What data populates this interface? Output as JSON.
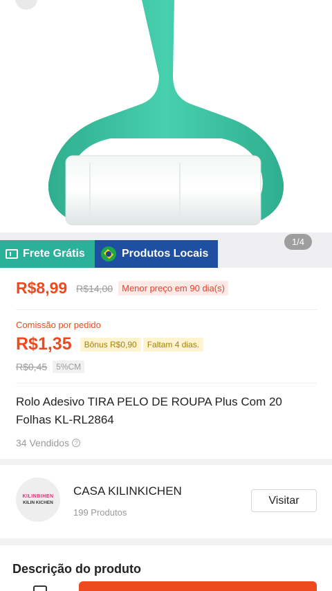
{
  "product": {
    "image_counter": "1/4",
    "tags": {
      "frete": "Frete Grátis",
      "local": "Produtos Locais"
    },
    "price": "R$8,99",
    "old_price": "R$14,00",
    "low_price_badge": "Menor preço em 90 dia(s)",
    "commission_label": "Comissão por pedido",
    "commission_value": "R$1,35",
    "bonus": "Bônus R$0,90",
    "days_left": "Faltam 4 dias.",
    "old_commission": "R$0,45",
    "commission_rate": "5%CM",
    "title": "Rolo Adesivo TIRA PELO DE ROUPA Plus Com 20 Folhas KL-RL2864",
    "sold": "34 Vendidos"
  },
  "shop": {
    "logo_top": "KILINBIHEN",
    "logo_text": "KILIN KICHEN",
    "name": "CASA KILINKICHEN",
    "product_count": "199 Produtos",
    "visit_label": "Visitar"
  },
  "description": {
    "title": "Descrição do produto"
  },
  "colors": {
    "accent": "#ee4a1f",
    "frete_green": "#2bb09a",
    "local_blue": "#1e4fa0",
    "roller_teal": "#3cc3a2"
  },
  "icons": {
    "back": "back-arrow-icon",
    "frete": "ticket-icon",
    "local": "brazil-flag-icon",
    "help": "question-circle-icon",
    "store": "store-icon"
  }
}
